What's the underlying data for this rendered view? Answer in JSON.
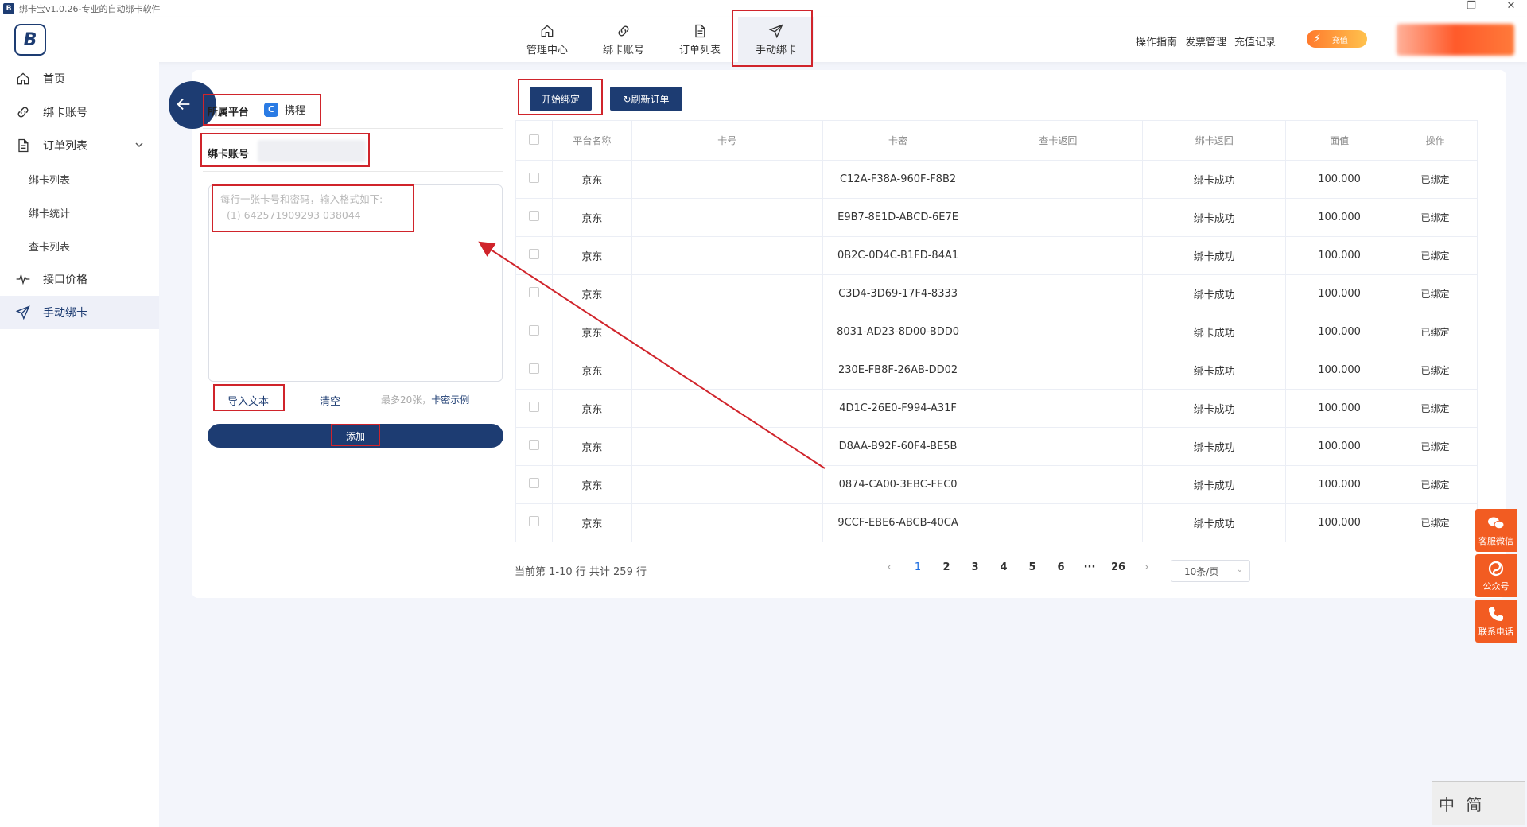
{
  "titlebar": {
    "text": "绑卡宝v1.0.26-专业的自动绑卡软件",
    "min": "—",
    "max": "❐",
    "close": "✕"
  },
  "header": {
    "logo_text": "B",
    "nav": [
      {
        "label": "管理中心",
        "icon": "home-icon"
      },
      {
        "label": "绑卡账号",
        "icon": "link-icon"
      },
      {
        "label": "订单列表",
        "icon": "document-icon"
      },
      {
        "label": "手动绑卡",
        "icon": "send-icon"
      }
    ],
    "links": [
      "操作指南",
      "发票管理",
      "充值记录"
    ],
    "recharge_label": "充值"
  },
  "sidebar": {
    "items": [
      {
        "label": "首页",
        "icon": "home-icon"
      },
      {
        "label": "绑卡账号",
        "icon": "link-icon"
      },
      {
        "label": "订单列表",
        "icon": "document-icon"
      },
      {
        "label": "绑卡列表"
      },
      {
        "label": "绑卡统计"
      },
      {
        "label": "查卡列表"
      },
      {
        "label": "接口价格",
        "icon": "pulse-icon"
      },
      {
        "label": "手动绑卡",
        "icon": "send-icon"
      }
    ]
  },
  "form": {
    "platform_label": "所属平台",
    "platform_value": "携程",
    "account_label": "绑卡账号",
    "textarea_placeholder": "每行一张卡号和密码，输入格式如下:\n  (1) 642571909293 038044",
    "import_label": "导入文本",
    "clear_label": "清空",
    "hint": "最多20张，",
    "example_label": "卡密示例",
    "add_label": "添加"
  },
  "toolbar": {
    "start_label": "开始绑定",
    "refresh_label": "↻刷新订单"
  },
  "table": {
    "headers": [
      "平台名称",
      "卡号",
      "卡密",
      "查卡返回",
      "绑卡返回",
      "面值",
      "操作"
    ],
    "rows": [
      {
        "platform": "京东",
        "card_no": "",
        "secret": "C12A-F38A-960F-F8B2",
        "query": "",
        "bind": "绑卡成功",
        "value": "100.000",
        "op": "已绑定"
      },
      {
        "platform": "京东",
        "card_no": "",
        "secret": "E9B7-8E1D-ABCD-6E7E",
        "query": "",
        "bind": "绑卡成功",
        "value": "100.000",
        "op": "已绑定"
      },
      {
        "platform": "京东",
        "card_no": "",
        "secret": "0B2C-0D4C-B1FD-84A1",
        "query": "",
        "bind": "绑卡成功",
        "value": "100.000",
        "op": "已绑定"
      },
      {
        "platform": "京东",
        "card_no": "",
        "secret": "C3D4-3D69-17F4-8333",
        "query": "",
        "bind": "绑卡成功",
        "value": "100.000",
        "op": "已绑定"
      },
      {
        "platform": "京东",
        "card_no": "",
        "secret": "8031-AD23-8D00-BDD0",
        "query": "",
        "bind": "绑卡成功",
        "value": "100.000",
        "op": "已绑定"
      },
      {
        "platform": "京东",
        "card_no": "",
        "secret": "230E-FB8F-26AB-DD02",
        "query": "",
        "bind": "绑卡成功",
        "value": "100.000",
        "op": "已绑定"
      },
      {
        "platform": "京东",
        "card_no": "",
        "secret": "4D1C-26E0-F994-A31F",
        "query": "",
        "bind": "绑卡成功",
        "value": "100.000",
        "op": "已绑定"
      },
      {
        "platform": "京东",
        "card_no": "",
        "secret": "D8AA-B92F-60F4-BE5B",
        "query": "",
        "bind": "绑卡成功",
        "value": "100.000",
        "op": "已绑定"
      },
      {
        "platform": "京东",
        "card_no": "",
        "secret": "0874-CA00-3EBC-FEC0",
        "query": "",
        "bind": "绑卡成功",
        "value": "100.000",
        "op": "已绑定"
      },
      {
        "platform": "京东",
        "card_no": "",
        "secret": "9CCF-EBE6-ABCB-40CA",
        "query": "",
        "bind": "绑卡成功",
        "value": "100.000",
        "op": "已绑定"
      }
    ]
  },
  "pagination": {
    "info": "当前第 1-10 行 共计 259 行",
    "prev": "‹",
    "pages": [
      "1",
      "2",
      "3",
      "4",
      "5",
      "6",
      "···",
      "26"
    ],
    "next": "›",
    "current": "1",
    "page_size": "10条/页"
  },
  "float": [
    {
      "label": "客服微信",
      "icon": "wechat-icon"
    },
    {
      "label": "公众号",
      "icon": "official-account-icon"
    },
    {
      "label": "联系电话",
      "icon": "phone-icon"
    }
  ],
  "stamp": "中 简"
}
